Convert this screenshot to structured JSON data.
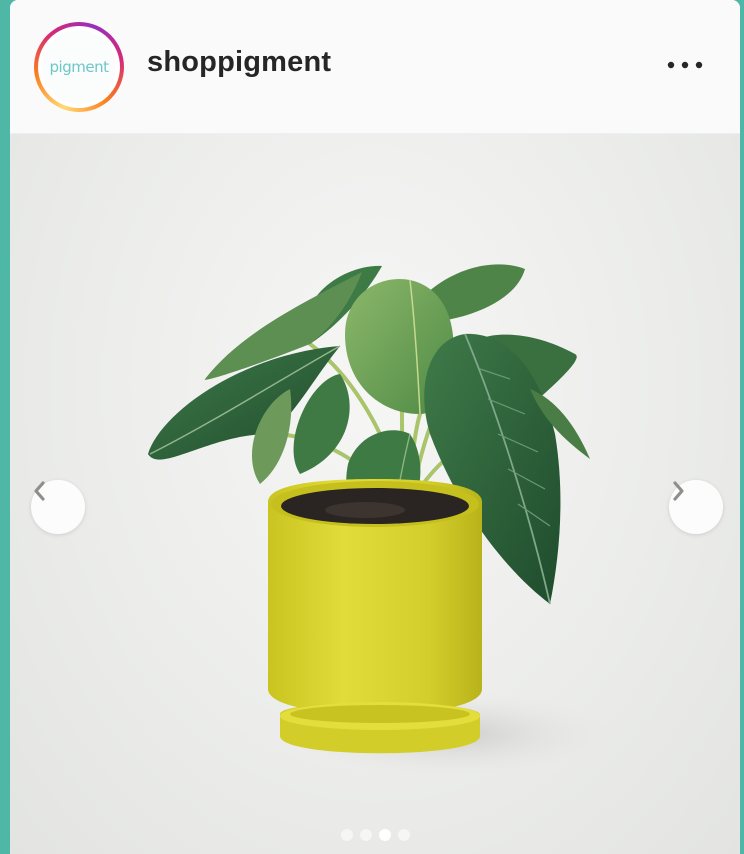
{
  "post": {
    "username": "shoppigment",
    "avatar_text": "pigment",
    "more_icon": "more-horizontal-icon",
    "carousel": {
      "total_slides": 4,
      "active_index": 2,
      "prev_icon": "chevron-left-icon",
      "next_icon": "chevron-right-icon"
    }
  },
  "colors": {
    "page_background": "#4fb7a6",
    "header_background": "#fafafa",
    "username": "#262626",
    "avatar_text": "#6cc7c9",
    "pot": "#d6d12e",
    "leaf": "#2f6b39"
  }
}
